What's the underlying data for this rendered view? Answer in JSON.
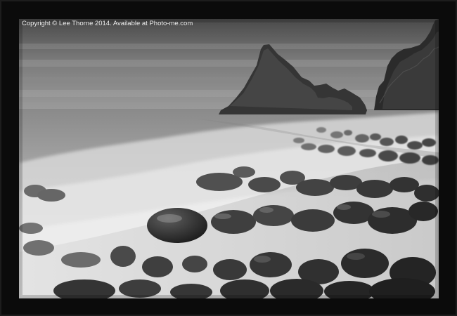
{
  "watermark": {
    "text": "Copyright © Lee Thorne 2014. Available at Photo-me.com"
  },
  "frame": {
    "color": "#0b0b0b"
  },
  "photo": {
    "tone": "black-and-white long-exposure seascape"
  }
}
